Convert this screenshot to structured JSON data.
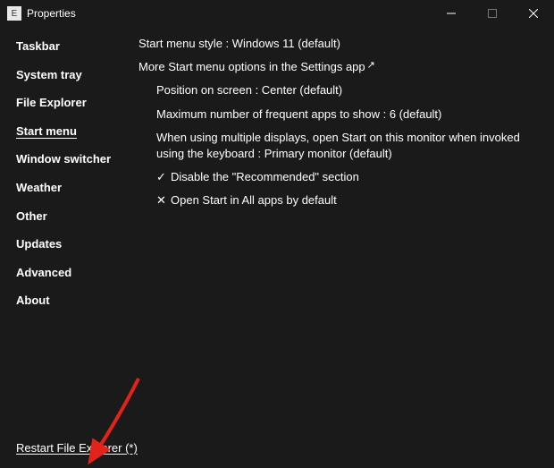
{
  "window": {
    "title": "Properties",
    "icon_label": "E"
  },
  "sidebar": {
    "items": [
      {
        "label": "Taskbar"
      },
      {
        "label": "System tray"
      },
      {
        "label": "File Explorer"
      },
      {
        "label": "Start menu"
      },
      {
        "label": "Window switcher"
      },
      {
        "label": "Weather"
      },
      {
        "label": "Other"
      },
      {
        "label": "Updates"
      },
      {
        "label": "Advanced"
      },
      {
        "label": "About"
      }
    ],
    "active_index": 3
  },
  "main": {
    "style_label": "Start menu style : Windows 11 (default)",
    "more_options_label": "More Start menu options in the Settings app",
    "position_label": "Position on screen : Center (default)",
    "max_frequent_label": "Maximum number of frequent apps to show : 6 (default)",
    "multi_display_label": "When using multiple displays, open Start on this monitor when invoked using the keyboard : Primary monitor (default)",
    "disable_recommended_label": "Disable the \"Recommended\" section",
    "open_all_apps_label": "Open Start in All apps by default",
    "disable_recommended_checked": true,
    "open_all_apps_checked": false
  },
  "footer": {
    "restart_label": "Restart File Explorer (*)"
  }
}
